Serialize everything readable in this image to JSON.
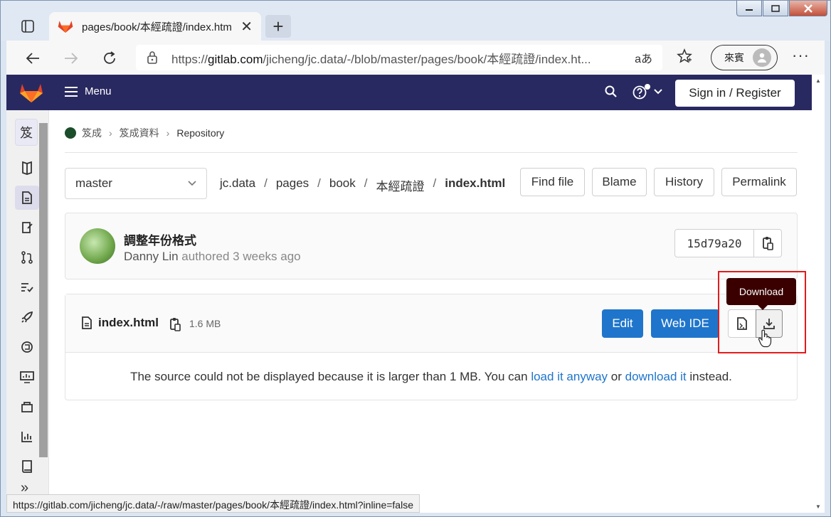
{
  "browser": {
    "tab_title": "pages/book/本經疏證/index.htm",
    "tab_close": "✕",
    "new_tab": "+",
    "url_prefix": "https://",
    "url_host": "gitlab.com",
    "url_path": "/jicheng/jc.data/-/blob/master/pages/book/本經疏證/index.ht...",
    "read_aloud": "aあ",
    "profile_label": "來賓",
    "more": "···",
    "status_url": "https://gitlab.com/jicheng/jc.data/-/raw/master/pages/book/本經疏證/index.html?inline=false"
  },
  "gitlab": {
    "menu_label": "Menu",
    "sign_in": "Sign in / Register",
    "sidebar_project_initial": "笈",
    "sidebar_collapse": "»"
  },
  "breadcrumb": [
    "笈成",
    "笈成資料",
    "Repository"
  ],
  "repo": {
    "branch": "master",
    "path": [
      "jc.data",
      "pages",
      "book",
      "本經疏證"
    ],
    "path_sep": "/",
    "file": "index.html",
    "buttons": {
      "find": "Find file",
      "blame": "Blame",
      "history": "History",
      "permalink": "Permalink"
    }
  },
  "commit": {
    "title": "調整年份格式",
    "author": "Danny Lin",
    "authored": "authored",
    "when": "3 weeks ago",
    "sha": "15d79a20"
  },
  "file_view": {
    "name": "index.html",
    "size": "1.6 MB",
    "edit": "Edit",
    "web_ide": "Web IDE",
    "tooltip": "Download",
    "msg_before": "The source could not be displayed because it is larger than 1 MB. You can ",
    "link_load": "load it anyway",
    "msg_or": " or ",
    "link_download": "download it",
    "msg_after": " instead."
  }
}
